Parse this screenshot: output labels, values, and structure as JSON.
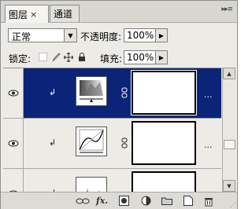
{
  "tabs": [
    {
      "label": "图层",
      "close": "×",
      "active": true
    },
    {
      "label": "通道",
      "active": false
    }
  ],
  "panel_menu_icon": "panel-menu-icon",
  "blend_mode": {
    "value": "正常"
  },
  "opacity": {
    "label": "不透明度:",
    "value": "100%"
  },
  "lock": {
    "label": "锁定:",
    "icons": [
      "lock-transparent-icon",
      "lock-image-icon",
      "lock-position-icon",
      "lock-all-icon"
    ]
  },
  "fill": {
    "label": "填充:",
    "value": "100%"
  },
  "layers": [
    {
      "type": "levels-adjustment",
      "selected": true,
      "clip_glyph": "↲",
      "more": "..."
    },
    {
      "type": "curves-adjustment",
      "selected": false,
      "clip_glyph": "↲",
      "more": "..."
    },
    {
      "type": "histogram-adjustment",
      "selected": false,
      "clip_glyph": "↲",
      "more": "..."
    }
  ],
  "bottom_bar": {
    "fx_label": "fx."
  },
  "colors": {
    "selected_row": "#0b2477",
    "panel_bg": "#ecebe6"
  }
}
